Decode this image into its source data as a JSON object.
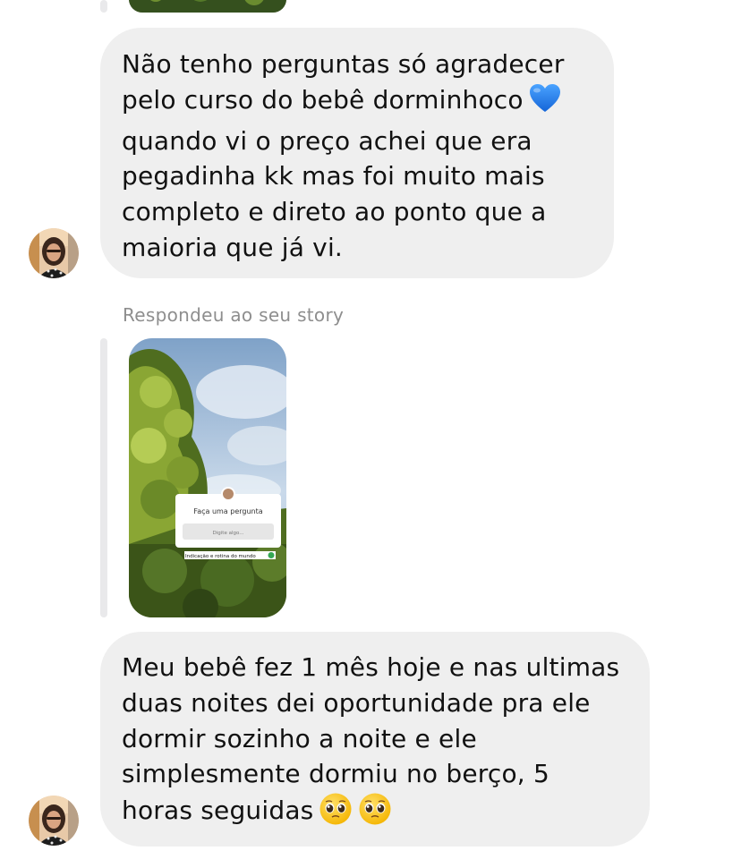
{
  "conversation": {
    "messages": [
      {
        "lines": [
          "Não tenho perguntas só agradecer",
          "pelo curso do bebê dorminhoco",
          "quando vi o preço achei que era",
          "pegadinha kk mas foi muito mais",
          "completo e direto ao ponto que a",
          "maioria que já vi."
        ],
        "emoji": "blue-heart"
      },
      {
        "lines": [
          "Meu bebê fez 1 mês hoje e nas ultimas",
          "duas noites dei oportunidade pra ele",
          "dormir sozinho a noite e ele",
          "simplesmente dormiu no berço, 5",
          "horas seguidas"
        ],
        "emoji": "pleading-face"
      }
    ],
    "story_reply_caption": "Respondeu ao seu story",
    "story_card": {
      "prompt": "Faça uma pergunta",
      "input_placeholder": "Digite algo...",
      "tag_text": "Indicação e rotina do mundo"
    }
  },
  "colors": {
    "bubble_bg": "#efefef",
    "text": "#111111",
    "caption": "#8e8e8e",
    "reply_line": "#e9e9eb",
    "heart": "#1f7ee8"
  }
}
